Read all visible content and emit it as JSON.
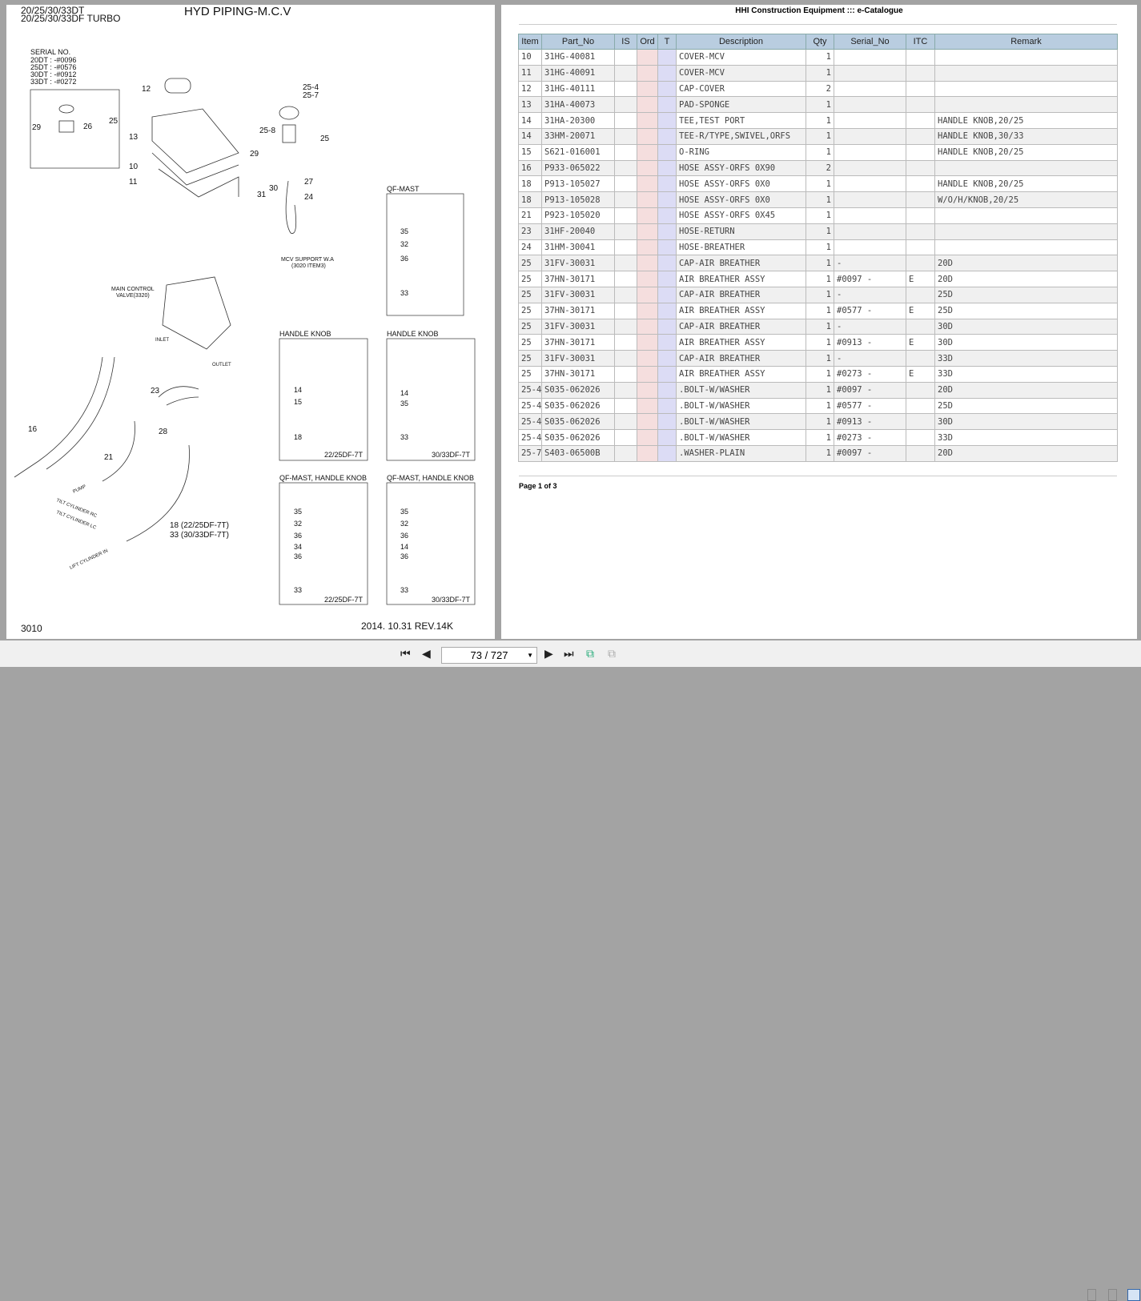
{
  "drawing": {
    "model_line1": "20/25/30/33DT",
    "model_line2": "20/25/30/33DF TURBO",
    "title": "HYD PIPING-M.C.V",
    "serial_title": "SERIAL NO.",
    "serials": [
      "20DT : -#0096",
      "25DT : -#0576",
      "30DT : -#0912",
      "33DT : -#0272"
    ],
    "page_code": "3010",
    "revision": "2014. 10.31  REV.14K",
    "labels": [
      "12",
      "13",
      "10",
      "11",
      "25",
      "26",
      "29",
      "25-4",
      "25-7",
      "25-8",
      "25",
      "29",
      "27",
      "30",
      "24",
      "31",
      "MCV SUPPORT W.A",
      "(3020 ITEM3)",
      "MAIN CONTROL",
      "VALVE(3320)",
      "OUTLET",
      "INLET",
      "23",
      "28",
      "16",
      "21",
      "18 (22/25DF-7T)",
      "33 (30/33DF-7T)",
      "PUMP",
      "TILT CYLINDER RC",
      "TILT CYLINDER LC",
      "LIFT CYLINDER IN"
    ],
    "insets": [
      {
        "title": "QF-MAST",
        "labels": [
          "35",
          "32",
          "36",
          "33"
        ],
        "caption": ""
      },
      {
        "title": "HANDLE KNOB",
        "labels": [
          "14",
          "15",
          "18"
        ],
        "caption": "22/25DF-7T"
      },
      {
        "title": "HANDLE KNOB",
        "labels": [
          "14",
          "35",
          "33"
        ],
        "caption": "30/33DF-7T"
      },
      {
        "title": "QF-MAST, HANDLE KNOB",
        "labels": [
          "35",
          "32",
          "36",
          "34",
          "36",
          "33"
        ],
        "caption": "22/25DF-7T"
      },
      {
        "title": "QF-MAST, HANDLE KNOB",
        "labels": [
          "35",
          "32",
          "36",
          "14",
          "36",
          "33"
        ],
        "caption": "30/33DF-7T"
      }
    ]
  },
  "catalogue": {
    "title": "HHI Construction Equipment ::: e-Catalogue",
    "columns": [
      "Item",
      "Part_No",
      "IS",
      "Ord",
      "T",
      "Description",
      "Qty",
      "Serial_No",
      "ITC",
      "Remark"
    ],
    "rows": [
      [
        "10",
        "31HG-40081",
        "",
        "",
        "",
        "COVER-MCV",
        "1",
        "",
        "",
        ""
      ],
      [
        "11",
        "31HG-40091",
        "",
        "",
        "",
        "COVER-MCV",
        "1",
        "",
        "",
        ""
      ],
      [
        "12",
        "31HG-40111",
        "",
        "",
        "",
        "CAP-COVER",
        "2",
        "",
        "",
        ""
      ],
      [
        "13",
        "31HA-40073",
        "",
        "",
        "",
        "PAD-SPONGE",
        "1",
        "",
        "",
        ""
      ],
      [
        "14",
        "31HA-20300",
        "",
        "",
        "",
        "TEE,TEST PORT",
        "1",
        "",
        "",
        "HANDLE KNOB,20/25"
      ],
      [
        "14",
        "33HM-20071",
        "",
        "",
        "",
        "TEE-R/TYPE,SWIVEL,ORFS",
        "1",
        "",
        "",
        "HANDLE KNOB,30/33"
      ],
      [
        "15",
        "S621-016001",
        "",
        "",
        "",
        "O-RING",
        "1",
        "",
        "",
        "HANDLE KNOB,20/25"
      ],
      [
        "16",
        "P933-065022",
        "",
        "",
        "",
        "HOSE ASSY-ORFS 0X90",
        "2",
        "",
        "",
        ""
      ],
      [
        "18",
        "P913-105027",
        "",
        "",
        "",
        "HOSE ASSY-ORFS 0X0",
        "1",
        "",
        "",
        "HANDLE KNOB,20/25"
      ],
      [
        "18",
        "P913-105028",
        "",
        "",
        "",
        "HOSE ASSY-ORFS 0X0",
        "1",
        "",
        "",
        "W/O/H/KNOB,20/25"
      ],
      [
        "21",
        "P923-105020",
        "",
        "",
        "",
        "HOSE ASSY-ORFS 0X45",
        "1",
        "",
        "",
        ""
      ],
      [
        "23",
        "31HF-20040",
        "",
        "",
        "",
        "HOSE-RETURN",
        "1",
        "",
        "",
        ""
      ],
      [
        "24",
        "31HM-30041",
        "",
        "",
        "",
        "HOSE-BREATHER",
        "1",
        "",
        "",
        ""
      ],
      [
        "25",
        "31FV-30031",
        "",
        "",
        "",
        "CAP-AIR BREATHER",
        "1",
        "          -",
        "",
        "20D"
      ],
      [
        "25",
        "37HN-30171",
        "",
        "",
        "",
        "AIR BREATHER ASSY",
        "1",
        "#0097 -",
        "E",
        "20D"
      ],
      [
        "25",
        "31FV-30031",
        "",
        "",
        "",
        "CAP-AIR BREATHER",
        "1",
        "          -",
        "",
        "25D"
      ],
      [
        "25",
        "37HN-30171",
        "",
        "",
        "",
        "AIR BREATHER ASSY",
        "1",
        "#0577 -",
        "E",
        "25D"
      ],
      [
        "25",
        "31FV-30031",
        "",
        "",
        "",
        "CAP-AIR BREATHER",
        "1",
        "          -",
        "",
        "30D"
      ],
      [
        "25",
        "37HN-30171",
        "",
        "",
        "",
        "AIR BREATHER ASSY",
        "1",
        "#0913 -",
        "E",
        "30D"
      ],
      [
        "25",
        "31FV-30031",
        "",
        "",
        "",
        "CAP-AIR BREATHER",
        "1",
        "          -",
        "",
        "33D"
      ],
      [
        "25",
        "37HN-30171",
        "",
        "",
        "",
        "AIR BREATHER ASSY",
        "1",
        "#0273 -",
        "E",
        "33D"
      ],
      [
        "25-4",
        "S035-062026",
        "",
        "",
        "",
        ".BOLT-W/WASHER",
        "1",
        "#0097 -",
        "",
        "20D"
      ],
      [
        "25-4",
        "S035-062026",
        "",
        "",
        "",
        ".BOLT-W/WASHER",
        "1",
        "#0577 -",
        "",
        "25D"
      ],
      [
        "25-4",
        "S035-062026",
        "",
        "",
        "",
        ".BOLT-W/WASHER",
        "1",
        "#0913 -",
        "",
        "30D"
      ],
      [
        "25-4",
        "S035-062026",
        "",
        "",
        "",
        ".BOLT-W/WASHER",
        "1",
        "#0273 -",
        "",
        "33D"
      ],
      [
        "25-7",
        "S403-06500B",
        "",
        "",
        "",
        ".WASHER-PLAIN",
        "1",
        "#0097 -",
        "",
        "20D"
      ]
    ],
    "page_info": "Page 1 of 3"
  },
  "toolbar": {
    "page_value": "73 / 727",
    "icons": [
      "first-page-icon",
      "prev-page-icon",
      "next-page-icon",
      "last-page-icon",
      "fit-page-icon",
      "fit-width-icon",
      "single-page-view-icon",
      "continuous-view-icon",
      "two-page-view-icon"
    ]
  },
  "colors": {
    "header_bg": "#b9cde0",
    "ord_col": "#f5dede",
    "t_col": "#dcdcf5",
    "background": "#a3a3a3"
  }
}
